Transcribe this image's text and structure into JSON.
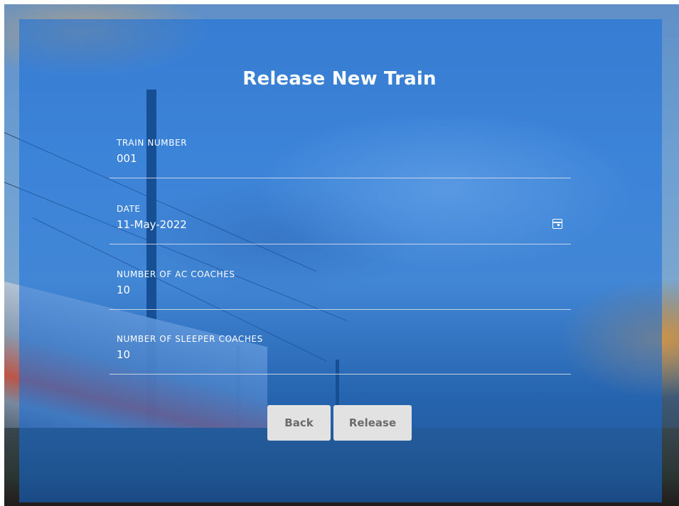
{
  "form": {
    "title": "Release New Train",
    "fields": [
      {
        "label": "TRAIN NUMBER",
        "value": "001"
      },
      {
        "label": "DATE",
        "value": "11-May-2022",
        "icon": "calendar-icon"
      },
      {
        "label": "NUMBER OF AC COACHES",
        "value": "10"
      },
      {
        "label": "NUMBER OF SLEEPER COACHES",
        "value": "10"
      }
    ],
    "buttons": {
      "back_label": "Back",
      "release_label": "Release"
    }
  },
  "colors": {
    "card_overlay": "#1e6edc",
    "text": "#ffffff",
    "button_bg": "#e2e2e2",
    "button_text": "#6b6b6b"
  }
}
